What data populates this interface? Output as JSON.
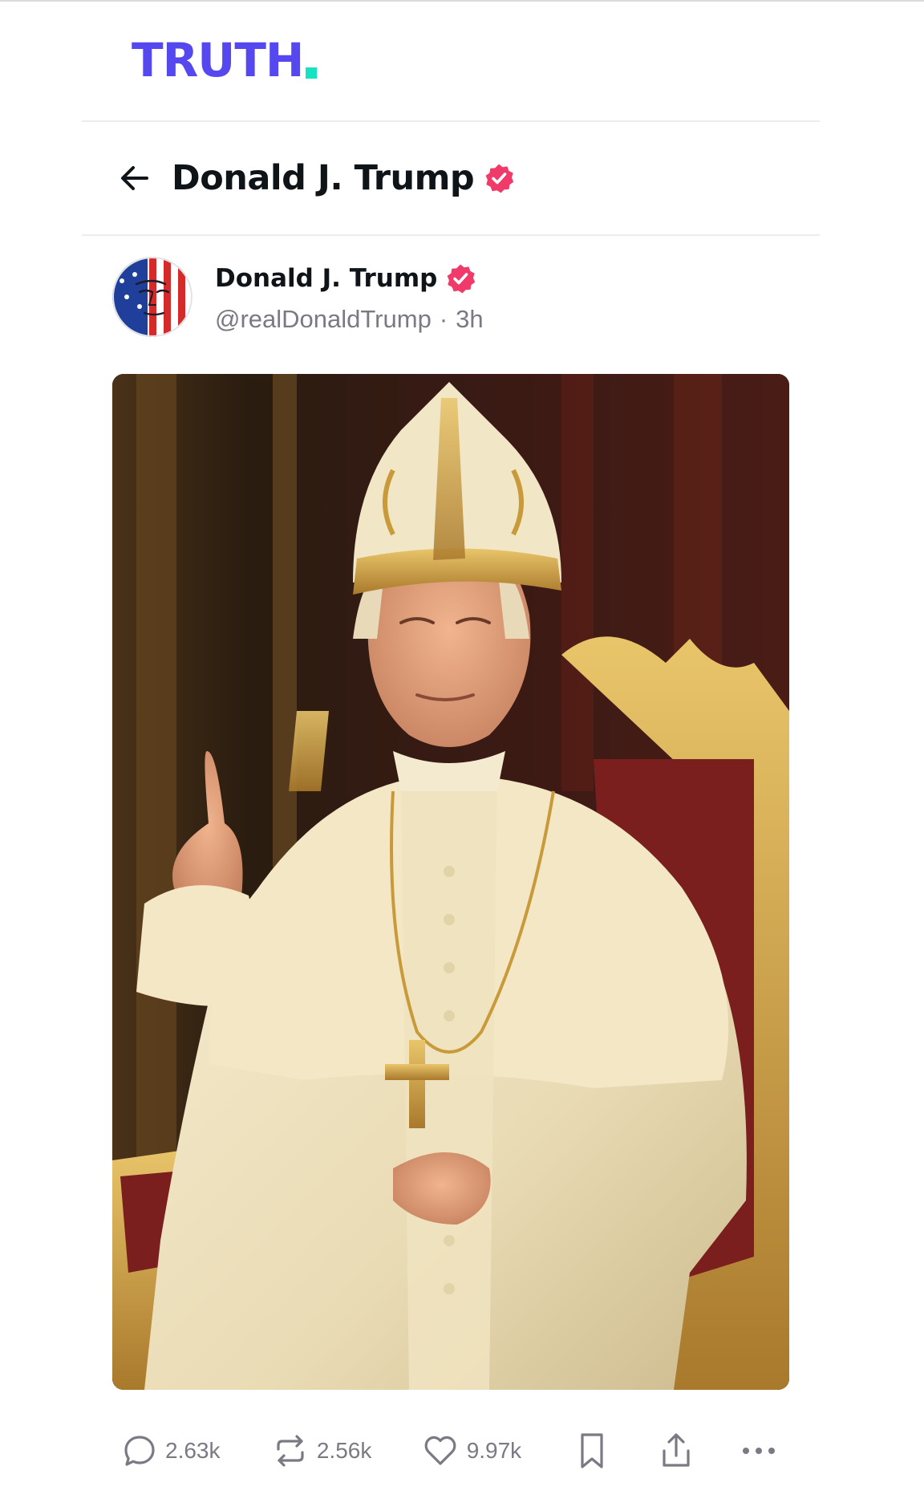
{
  "app": {
    "brand": "TRUTH",
    "brand_color": "#5448ee",
    "brand_dot_color": "#17e3c2"
  },
  "header": {
    "back_icon": "arrow-left-icon",
    "title": "Donald J. Trump",
    "verified_icon": "verified-badge-icon",
    "verified_color": "#f03a6a"
  },
  "post": {
    "author_name": "Donald J. Trump",
    "handle": "@realDonaldTrump",
    "separator": "·",
    "time": "3h",
    "avatar_icon": "flag-face-avatar",
    "media_icon": "papal-portrait-image",
    "actions": {
      "replies": {
        "icon": "reply-bubble-icon",
        "count": "2.63k"
      },
      "reposts": {
        "icon": "repost-icon",
        "count": "2.56k"
      },
      "likes": {
        "icon": "heart-icon",
        "count": "9.97k"
      },
      "bookmark": {
        "icon": "bookmark-icon"
      },
      "share": {
        "icon": "share-icon"
      },
      "more": {
        "icon": "more-dots-icon"
      }
    }
  }
}
